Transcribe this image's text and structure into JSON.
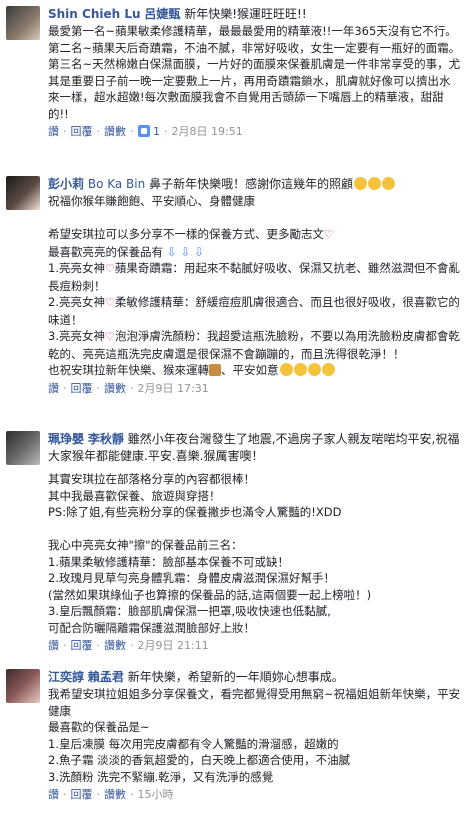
{
  "comments": [
    {
      "author": "Shin Chieh Lu",
      "subtitle": "呂婕甄",
      "inline_text": "新年快樂!猴運旺旺旺!!",
      "body": "最愛第一名~蘋果敏柔修護精華，最最最愛用的精華液!!一年365天沒有它不行。\n第二名~蘋果天后奇蹟霜，不油不膩，非常好吸收，女生一定要有一瓶好的面霜。\n第三名~天然棉嫩白保濕面膜，一片好的面膜來保養肌膚是一件非常享受的事，尤其是重要日子前一晚一定要敷上一片，再用奇蹟霜鎖水，肌膚就好像可以擠出水來一樣，超水超嫩!每次敷面膜我會不自覺用舌頭舔一下嘴唇上的精華液，甜甜的!!",
      "actions": [
        "讚",
        "回覆",
        "讚數"
      ],
      "likes": "1",
      "time": "2月8日 19:51"
    },
    {
      "author": "彭小莉",
      "subtitle": "Bo Ka Bin",
      "inline_text": "鼻子新年快樂哦！感謝你這幾年的照顧",
      "body_lines": [
        "祝福你猴年賺飽飽、平安順心、身體健康",
        "",
        "希望安琪拉可以多分享不一樣的保養方式、更多勵志文",
        "最喜歡亮亮的保養品有",
        "1.亮亮女神",
        "蘋果奇蹟霜：用起來不黏膩好吸收、保濕又抗老、雖然滋潤但不會亂長痘粉刺！",
        "2.亮亮女神",
        "柔敏修護精華：舒緩痘痘肌膚很適合、而且也很好吸收，很喜歡它的味道！",
        "3.亮亮女神",
        "泡泡淨膚洗顏粉：我超愛這瓶洗臉粉，不要以為用洗臉粉皮膚都會乾乾的、亮亮這瓶洗完皮膚還是很保濕不會蹦蹦的，而且洗得很乾淨！！",
        "也祝安琪拉新年快樂、猴來運轉",
        "、平安如意"
      ],
      "actions": [
        "讚",
        "回覆",
        "讚數"
      ],
      "time": "2月9日 17:31"
    },
    {
      "author": "珮琤嬰",
      "subtitle": "李秋靜",
      "inline_text": "雖然小年夜台灣發生了地震,不過房子家人親友啱啱均平安,祝福大家猴年都能健康.平安.喜樂.猴厲害噢！",
      "body": "其實安琪拉在部落格分享的內容都很棒！\n其中我最喜歡保養、旅遊與穿搭！\nPS:除了姐,有些亮粉分享的保養撇步也滿令人驚豔的!XDD\n\n我心中亮亮女神\"擦\"的保養品前三名：\n1.蘋果柔敏修護精華：臉部基本保養不可或缺！\n2.玫瑰月見草勻亮身體乳霜：身體皮膚滋潤保濕好幫手！\n(當然如果琪綠仙子也算擦的保養品的話,這兩個要一起上榜啦！)\n3.皇后飄顏霜：臉部肌膚保濕一把罩,吸收快速也低黏膩,\n可配合防曬隔離霜保護滋潤臉部好上妝！",
      "actions": [
        "讚",
        "回覆",
        "讚數"
      ],
      "time": "2月9日 21:11"
    },
    {
      "author": "江奕諄",
      "subtitle": "賴孟君",
      "inline_text": "新年快樂，希望新的一年順妳心想事成。",
      "body": "我希望安琪拉姐姐多分享保養文，看完都覺得受用無窮~祝福姐姐新年快樂，平安健康\n最喜歡的保養品是~\n1.皇后凍膜 每次用完皮膚都有令人驚豔的滑溜感，超嫩的\n2.魚子霜 淡淡的香氣超愛的，白天晚上都適合使用，不油膩\n3.洗顏粉 洗完不緊繃.乾淨，又有洗淨的感覺",
      "actions": [
        "讚",
        "回覆",
        "讚數"
      ],
      "time": "15小時"
    }
  ],
  "colors": {
    "link": "#365899",
    "meta": "#90949c",
    "text": "#1d2129",
    "like": "#5890ff",
    "heart": "#e0245e",
    "emoji": "#f5c33b"
  }
}
